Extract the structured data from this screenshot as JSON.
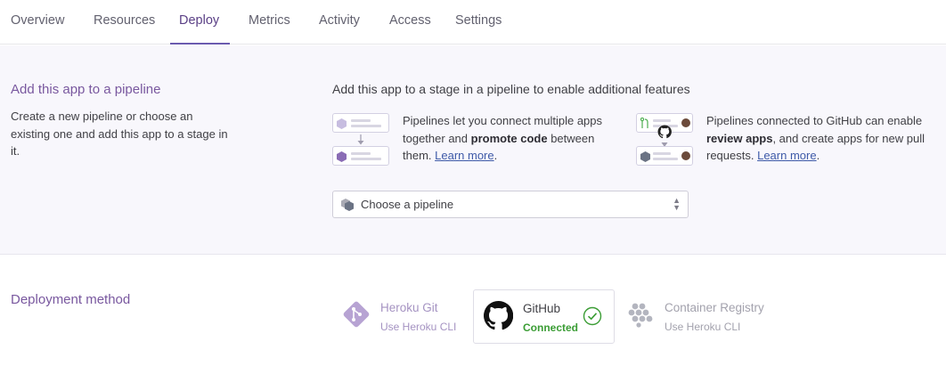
{
  "tabs": [
    {
      "label": "Overview"
    },
    {
      "label": "Resources"
    },
    {
      "label": "Deploy",
      "active": true
    },
    {
      "label": "Metrics"
    },
    {
      "label": "Activity"
    },
    {
      "label": "Access"
    },
    {
      "label": "Settings"
    }
  ],
  "pipeline": {
    "title": "Add this app to a pipeline",
    "description": "Create a new pipeline or choose an existing one and add this app to a stage in it.",
    "headline": "Add this app to a stage in a pipeline to enable additional features",
    "feature_pipelines": {
      "text_before": "Pipelines let you connect multiple apps together and ",
      "bold": "promote code",
      "text_after": " between them. ",
      "link": "Learn more",
      "end": "."
    },
    "feature_github": {
      "text_before": "Pipelines connected to GitHub can enable ",
      "bold": "review apps",
      "text_after": ", and create apps for new pull requests. ",
      "link": "Learn more",
      "end": "."
    },
    "select_placeholder": "Choose a pipeline"
  },
  "deployment": {
    "title": "Deployment method",
    "methods": [
      {
        "name": "Heroku Git",
        "sub": "Use Heroku CLI",
        "icon": "heroku-git-icon"
      },
      {
        "name": "GitHub",
        "sub": "Connected",
        "icon": "github-icon",
        "selected": true
      },
      {
        "name": "Container Registry",
        "sub": "Use Heroku CLI",
        "icon": "container-registry-icon"
      }
    ]
  },
  "colors": {
    "accent": "#79589f",
    "connected": "#3b9d35",
    "link": "#3e5aa8"
  }
}
